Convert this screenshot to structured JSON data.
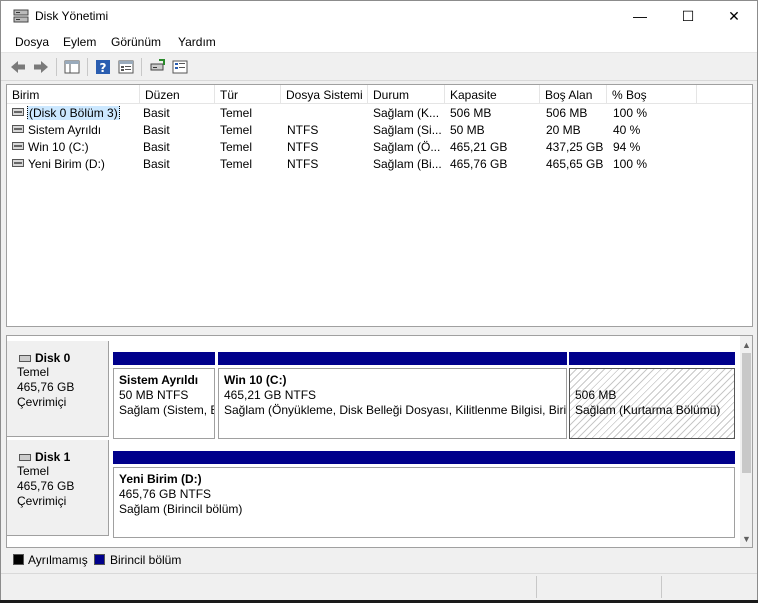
{
  "window": {
    "title": "Disk Yönetimi",
    "minimize": "—",
    "maximize": "☐",
    "close": "✕"
  },
  "menu": [
    "Dosya",
    "Eylem",
    "Görünüm",
    "Yardım"
  ],
  "toolbar": {
    "icons": [
      "back-arrow-icon",
      "forward-arrow-icon",
      "console-tree-icon",
      "help-icon",
      "properties-icon",
      "connect-disk-icon",
      "list-view-icon"
    ]
  },
  "volume_list": {
    "columns": [
      "Birim",
      "Düzen",
      "Tür",
      "Dosya Sistemi",
      "Durum",
      "Kapasite",
      "Boş Alan",
      "% Boş"
    ],
    "rows": [
      {
        "birim": "(Disk 0 Bölüm 3)",
        "duzen": "Basit",
        "tur": "Temel",
        "dosya_sistemi": "",
        "durum": "Sağlam (K...",
        "kapasite": "506 MB",
        "bos_alan": "506 MB",
        "yuzde_bos": "100 %"
      },
      {
        "birim": "Sistem Ayrıldı",
        "duzen": "Basit",
        "tur": "Temel",
        "dosya_sistemi": "NTFS",
        "durum": "Sağlam (Si...",
        "kapasite": "50 MB",
        "bos_alan": "20 MB",
        "yuzde_bos": "40 %"
      },
      {
        "birim": "Win 10 (C:)",
        "duzen": "Basit",
        "tur": "Temel",
        "dosya_sistemi": "NTFS",
        "durum": "Sağlam (Ö...",
        "kapasite": "465,21 GB",
        "bos_alan": "437,25 GB",
        "yuzde_bos": "94 %"
      },
      {
        "birim": "Yeni Birim (D:)",
        "duzen": "Basit",
        "tur": "Temel",
        "dosya_sistemi": "NTFS",
        "durum": "Sağlam (Bi...",
        "kapasite": "465,76 GB",
        "bos_alan": "465,65 GB",
        "yuzde_bos": "100 %"
      }
    ]
  },
  "disks": [
    {
      "name": "Disk 0",
      "type": "Temel",
      "size": "465,76 GB",
      "status": "Çevrimiçi",
      "partitions": [
        {
          "title": "Sistem Ayrıldı",
          "size": "50 MB NTFS",
          "status": "Sağlam (Sistem, E"
        },
        {
          "title": "Win 10  (C:)",
          "size": "465,21 GB NTFS",
          "status": "Sağlam (Önyükleme, Disk Belleği Dosyası, Kilitlenme Bilgisi, Birin"
        },
        {
          "title": "",
          "size": "506 MB",
          "status": "Sağlam (Kurtarma Bölümü)"
        }
      ]
    },
    {
      "name": "Disk 1",
      "type": "Temel",
      "size": "465,76 GB",
      "status": "Çevrimiçi",
      "partitions": [
        {
          "title": "Yeni Birim  (D:)",
          "size": "465,76 GB NTFS",
          "status": "Sağlam (Birincil bölüm)"
        }
      ]
    }
  ],
  "legend": [
    {
      "label": "Ayrılmamış",
      "color": "#000000"
    },
    {
      "label": "Birincil bölüm",
      "color": "#00008b"
    }
  ],
  "colors": {
    "primary_partition": "#00008b",
    "selection": "#cce8ff"
  }
}
